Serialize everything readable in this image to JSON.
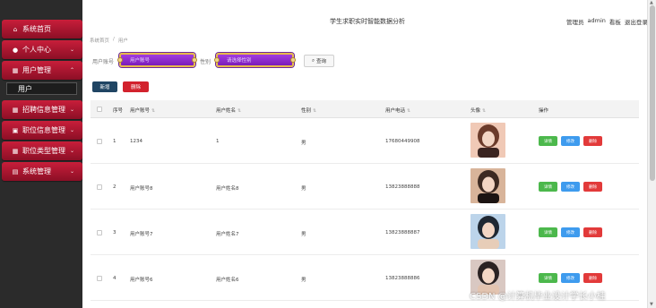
{
  "app": {
    "title": "学生求职实时智能数据分析"
  },
  "header": {
    "role": "管理员",
    "user": "admin",
    "dashboard": "看板",
    "logout": "退出登录"
  },
  "breadcrumb": {
    "home": "系统首页",
    "sep": "/",
    "current": "用户"
  },
  "sidebar": {
    "items": [
      {
        "label": "系统首页",
        "icon": "home-icon",
        "glyph": "⌂"
      },
      {
        "label": "个人中心",
        "icon": "person-icon",
        "glyph": "●"
      },
      {
        "label": "用户管理",
        "icon": "grid-icon",
        "glyph": "▦"
      },
      {
        "label": "招聘信息管理",
        "icon": "grid-icon",
        "glyph": "▦"
      },
      {
        "label": "职位信息管理",
        "icon": "briefcase-icon",
        "glyph": "▣"
      },
      {
        "label": "职位类型管理",
        "icon": "grid-icon",
        "glyph": "▦"
      },
      {
        "label": "系统管理",
        "icon": "doc-icon",
        "glyph": "▤"
      }
    ],
    "sub_item": "用户"
  },
  "search": {
    "account_label": "用户账号",
    "account_placeholder": "用户账号",
    "gender_label": "性别",
    "gender_placeholder": "请选择性别",
    "query_button": "查询"
  },
  "actions": {
    "new": "新增",
    "delete": "删除"
  },
  "table": {
    "columns": [
      "序号",
      "用户账号",
      "用户姓名",
      "性别",
      "用户电话",
      "头像",
      "操作"
    ],
    "rows": [
      {
        "index": "1",
        "account": "1234",
        "name": "1",
        "gender": "男",
        "phone": "17680449908",
        "avatar_palette": [
          "#f0c9b6",
          "#6b3b2a",
          "#3a2420"
        ]
      },
      {
        "index": "2",
        "account": "用户账号8",
        "name": "用户姓名8",
        "gender": "男",
        "phone": "13823888888",
        "avatar_palette": [
          "#d8b49a",
          "#3d2a22",
          "#1c1412"
        ]
      },
      {
        "index": "3",
        "account": "用户账号7",
        "name": "用户姓名7",
        "gender": "男",
        "phone": "13823888887",
        "avatar_palette": [
          "#bcd4ea",
          "#1f2833",
          "#e7cdb8"
        ]
      },
      {
        "index": "4",
        "account": "用户账号6",
        "name": "用户姓名6",
        "gender": "男",
        "phone": "13823888886",
        "avatar_palette": [
          "#d9c8c2",
          "#2a2222",
          "#e3c4b0"
        ]
      }
    ],
    "row_ops": {
      "detail": "详情",
      "edit": "修改",
      "delete": "删除"
    }
  },
  "watermark": "CSDN @计算机毕业设计学长小桂",
  "colors": {
    "sidebar_bg": "#2b2b2b",
    "menu_red": "#c81e3a",
    "input_purple": "#a23ce0",
    "input_gold": "#e6b94a",
    "new_btn": "#204563",
    "danger": "#d2222d",
    "success": "#4cb84c",
    "info": "#3e9bee"
  }
}
